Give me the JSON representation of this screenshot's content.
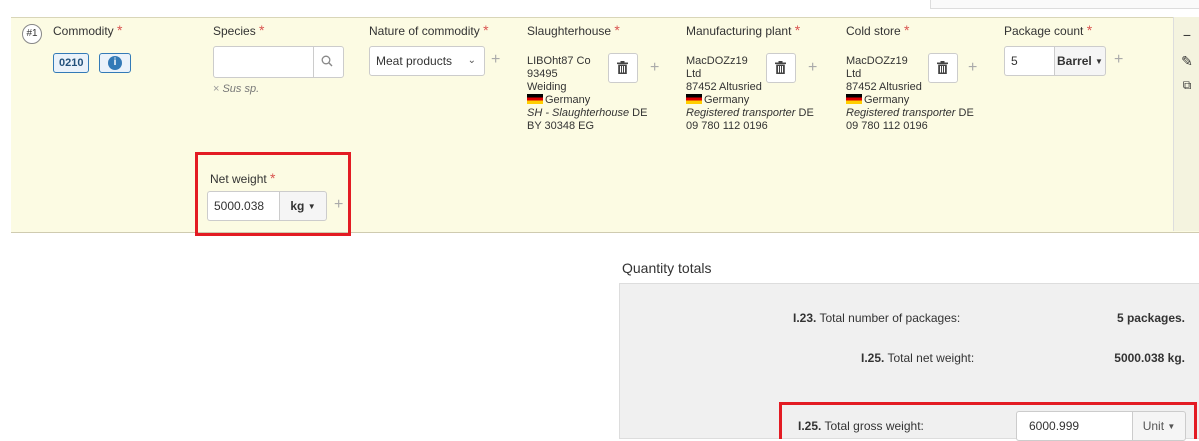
{
  "row": {
    "number": "#1",
    "headers": {
      "commodity": "Commodity",
      "species": "Species",
      "nature": "Nature of commodity",
      "slaughterhouse": "Slaughterhouse",
      "manufacturing": "Manufacturing plant",
      "cold_store": "Cold store",
      "package_count": "Package count"
    },
    "required_mark": "*",
    "commodity_code": "0210",
    "species": {
      "value": "",
      "name": "Sus sp.",
      "remove_symbol": "×"
    },
    "nature_value": "Meat products",
    "slaughterhouse": {
      "name_line1": "LIBOht87 Co",
      "name_line2": "93495",
      "city": "Weiding",
      "country": "Germany",
      "type": "SH - Slaughterhouse",
      "approval_l1": " DE",
      "approval_l2": "BY 30348 EG"
    },
    "manufacturing_plant": {
      "name_line1": "MacDOZz19",
      "name_line2": "Ltd",
      "city": "87452 Altusried",
      "country": "Germany",
      "type": "Registered transporter",
      "approval_l1": " DE",
      "approval_l2": "09 780 112 0196"
    },
    "cold_store": {
      "name_line1": "MacDOZz19",
      "name_line2": "Ltd",
      "city": "87452 Altusried",
      "country": "Germany",
      "type": "Registered transporter",
      "approval_l1": " DE",
      "approval_l2": "09 780 112 0196"
    },
    "package_count": {
      "value": "5",
      "unit": "Barrel"
    },
    "net_weight": {
      "label": "Net weight",
      "value": "5000.038",
      "unit": "kg"
    }
  },
  "quantity_totals": {
    "title": "Quantity totals",
    "packages": {
      "code": "I.23.",
      "label": "Total number of packages:",
      "value": "5 packages."
    },
    "net_weight": {
      "code": "I.25.",
      "label": "Total net weight:",
      "value": "5000.038 kg."
    },
    "gross_weight": {
      "code": "I.25.",
      "label": "Total gross weight:",
      "value": "6000.999",
      "unit": "Unit"
    }
  },
  "colors": {
    "highlight": "#e31b23",
    "row_bg": "#fcfbe3",
    "required": "#d9534f"
  }
}
